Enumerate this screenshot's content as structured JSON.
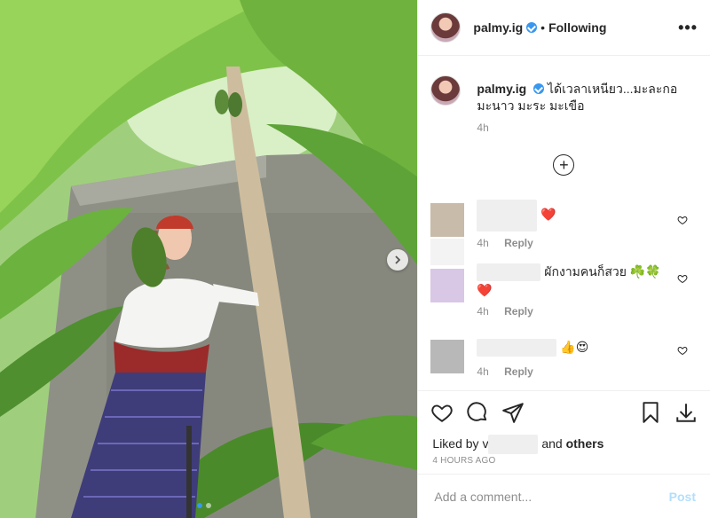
{
  "post": {
    "username": "palmy.ig",
    "bullet": "•",
    "follow_status": "Following",
    "more_label": "•••",
    "caption_text": "ได้เวลาเหนียว...มะละกอ มะนาว มะระ มะเขือ",
    "caption_time": "4h",
    "carousel_dots": 2,
    "active_dot": 0
  },
  "comments": [
    {
      "text": "",
      "emoji": "❤️",
      "time": "4h",
      "reply_label": "Reply",
      "avatar_color": "#c9bba9"
    },
    {
      "text": "ผักงามคนก็สวย",
      "emoji": "☘️🍀",
      "emoji2": "❤️",
      "time": "4h",
      "reply_label": "Reply",
      "avatar_color": "#d9c7e6"
    },
    {
      "text": "",
      "emoji": "👍😍",
      "time": "4h",
      "reply_label": "Reply",
      "avatar_color": "#b8b8b8"
    }
  ],
  "likes": {
    "prefix": "Liked by",
    "name_initial": "v",
    "suffix": "and",
    "others": "others"
  },
  "timestamp": "4 HOURS AGO",
  "composer": {
    "placeholder": "Add a comment...",
    "post_label": "Post"
  },
  "colors": {
    "accent": "#3897f0",
    "post_disabled": "#b2dffc",
    "heart_red": "#ed4956"
  }
}
